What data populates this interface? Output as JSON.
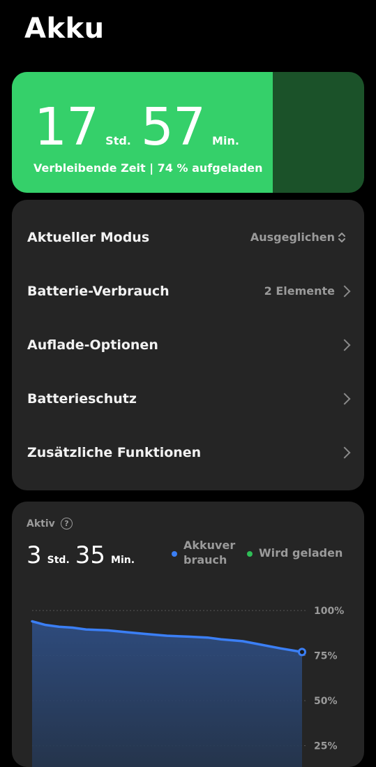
{
  "header": {
    "title": "Akku"
  },
  "battery": {
    "hours": "17",
    "hours_unit": "Std.",
    "minutes": "57",
    "minutes_unit": "Min.",
    "subtitle": "Verbleibende Zeit | 74 % aufgeladen",
    "level_percent": 74,
    "fill_color": "#35d06a",
    "empty_color": "#1b5229"
  },
  "settings": {
    "items": [
      {
        "label": "Aktueller Modus",
        "value": "Ausgeglichen",
        "icon": "up-down-chevron-icon"
      },
      {
        "label": "Batterie-Verbrauch",
        "value": "2 Elemente",
        "icon": "chevron-right-icon"
      },
      {
        "label": "Auflade-Optionen",
        "value": "",
        "icon": "chevron-right-icon"
      },
      {
        "label": "Batterieschutz",
        "value": "",
        "icon": "chevron-right-icon"
      },
      {
        "label": "Zusätzliche Funktionen",
        "value": "",
        "icon": "chevron-right-icon"
      }
    ]
  },
  "usage": {
    "label": "Aktiv",
    "help_icon": "question-circle-icon",
    "hours": "3",
    "hours_unit": "Std.",
    "minutes": "35",
    "minutes_unit": "Min.",
    "legend": [
      {
        "label_line1": "Akkuver",
        "label_line2": "brauch",
        "color": "#3b7ff5"
      },
      {
        "label_line1": "Wird geladen",
        "label_line2": "",
        "color": "#2fbe57"
      }
    ]
  },
  "chart_data": {
    "type": "area",
    "y_tick_labels": [
      "100%",
      "75%",
      "50%",
      "25%"
    ],
    "y_ticks": [
      100,
      75,
      50,
      25
    ],
    "ylim": [
      0,
      100
    ],
    "grid": true,
    "series": [
      {
        "name": "Akkuverbrauch",
        "color": "#3b7ff5",
        "x": [
          0,
          0.05,
          0.1,
          0.15,
          0.2,
          0.28,
          0.35,
          0.42,
          0.5,
          0.58,
          0.65,
          0.7,
          0.78,
          0.85,
          0.92,
          1.0
        ],
        "values": [
          94,
          92,
          91,
          90.5,
          89.5,
          89,
          88,
          87,
          86,
          85.5,
          85,
          84,
          83,
          81,
          79,
          77
        ]
      }
    ]
  }
}
